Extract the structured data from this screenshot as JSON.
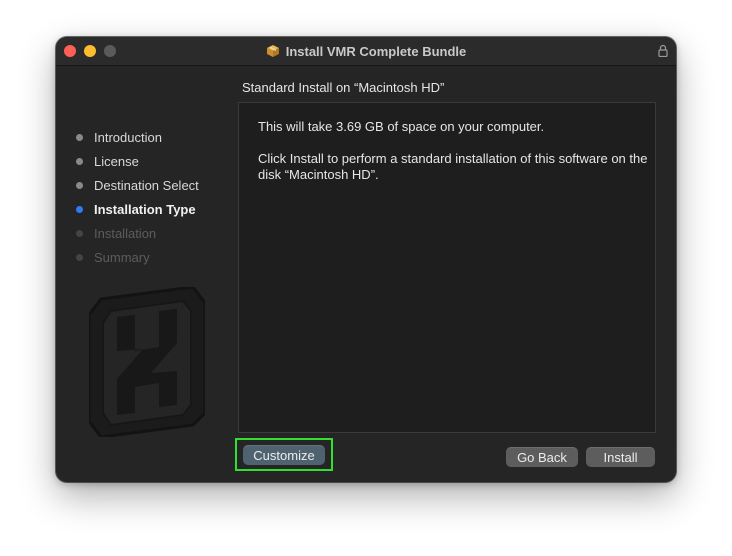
{
  "window": {
    "title": "Install VMR Complete Bundle",
    "icons": [
      "package-icon",
      "lock-icon"
    ]
  },
  "main": {
    "heading": "Standard Install on “Macintosh HD”",
    "paragraph1": "This will take 3.69 GB of space on your computer.",
    "paragraph2": "Click Install to perform a standard installation of this software on the disk “Macintosh HD”."
  },
  "sidebar": {
    "steps": [
      {
        "label": "Introduction",
        "state": "done"
      },
      {
        "label": "License",
        "state": "done"
      },
      {
        "label": "Destination Select",
        "state": "done"
      },
      {
        "label": "Installation Type",
        "state": "active"
      },
      {
        "label": "Installation",
        "state": "pending"
      },
      {
        "label": "Summary",
        "state": "pending"
      }
    ]
  },
  "buttons": {
    "customize": "Customize",
    "go_back": "Go Back",
    "install": "Install"
  },
  "colors": {
    "active_step": "#2f7bf5",
    "highlight": "#2fe02f",
    "window_bg": "#252525"
  }
}
